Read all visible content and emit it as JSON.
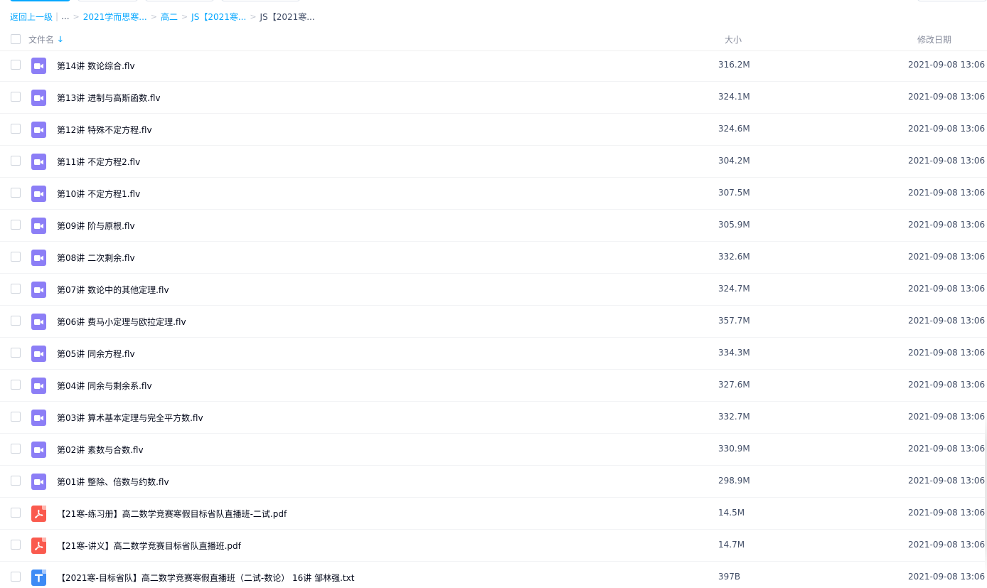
{
  "breadcrumb": {
    "back": "返回上一级",
    "ellipsis": "...",
    "items": [
      "2021学而思寒...",
      "高二",
      "JS【2021寒..."
    ],
    "current": "JS【2021寒..."
  },
  "header": {
    "name": "文件名",
    "sort_icon": "arrow-down-icon",
    "size": "大小",
    "date": "修改日期"
  },
  "files": [
    {
      "name": "第14讲 数论综合.flv",
      "size": "316.2M",
      "date": "2021-09-08 13:06",
      "type": "video"
    },
    {
      "name": "第13讲 进制与高斯函数.flv",
      "size": "324.1M",
      "date": "2021-09-08 13:06",
      "type": "video"
    },
    {
      "name": "第12讲 特殊不定方程.flv",
      "size": "324.6M",
      "date": "2021-09-08 13:06",
      "type": "video"
    },
    {
      "name": "第11讲 不定方程2.flv",
      "size": "304.2M",
      "date": "2021-09-08 13:06",
      "type": "video"
    },
    {
      "name": "第10讲 不定方程1.flv",
      "size": "307.5M",
      "date": "2021-09-08 13:06",
      "type": "video"
    },
    {
      "name": "第09讲 阶与原根.flv",
      "size": "305.9M",
      "date": "2021-09-08 13:06",
      "type": "video"
    },
    {
      "name": "第08讲 二次剩余.flv",
      "size": "332.6M",
      "date": "2021-09-08 13:06",
      "type": "video"
    },
    {
      "name": "第07讲 数论中的其他定理.flv",
      "size": "324.7M",
      "date": "2021-09-08 13:06",
      "type": "video"
    },
    {
      "name": "第06讲 费马小定理与欧拉定理.flv",
      "size": "357.7M",
      "date": "2021-09-08 13:06",
      "type": "video"
    },
    {
      "name": "第05讲 同余方程.flv",
      "size": "334.3M",
      "date": "2021-09-08 13:06",
      "type": "video"
    },
    {
      "name": "第04讲 同余与剩余系.flv",
      "size": "327.6M",
      "date": "2021-09-08 13:06",
      "type": "video"
    },
    {
      "name": "第03讲 算术基本定理与完全平方数.flv",
      "size": "332.7M",
      "date": "2021-09-08 13:06",
      "type": "video"
    },
    {
      "name": "第02讲 素数与合数.flv",
      "size": "330.9M",
      "date": "2021-09-08 13:06",
      "type": "video"
    },
    {
      "name": "第01讲 整除、倍数与约数.flv",
      "size": "298.9M",
      "date": "2021-09-08 13:06",
      "type": "video"
    },
    {
      "name": "【21寒-练习册】高二数学竞赛寒假目标省队直播班-二试.pdf",
      "size": "14.5M",
      "date": "2021-09-08 13:06",
      "type": "pdf"
    },
    {
      "name": "【21寒-讲义】高二数学竞赛目标省队直播班.pdf",
      "size": "14.7M",
      "date": "2021-09-08 13:06",
      "type": "pdf"
    },
    {
      "name": "【2021寒-目标省队】高二数学竞赛寒假直播班（二试-数论） 16讲 邹林强.txt",
      "size": "397B",
      "date": "2021-09-08 13:06",
      "type": "txt"
    }
  ],
  "icons": {
    "video": "video-file-icon",
    "pdf": "pdf-file-icon",
    "txt": "txt-file-icon"
  },
  "colors": {
    "accent": "#06a7ff",
    "video_icon": "#8c7ef6",
    "pdf_icon": "#fa5a4e",
    "txt_icon": "#3d8bf5"
  }
}
